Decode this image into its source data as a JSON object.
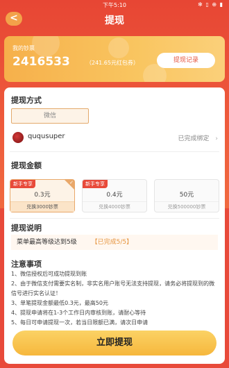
{
  "status_bar": {
    "time": "下午5:10",
    "icons": "✻ ▯ ⊕ ▮"
  },
  "nav": {
    "back_icon": "<",
    "title": "提现"
  },
  "balance": {
    "label": "我的钞票",
    "amount": "2416533",
    "note": "（241.65元红包券）",
    "record_button": "提现记录"
  },
  "withdraw_method": {
    "title": "提现方式",
    "selected_method": "微信",
    "username": "ququsuper",
    "bind_status": "已完成绑定"
  },
  "withdraw_amount": {
    "title": "提现金额",
    "options": [
      {
        "tag": "新手专享",
        "amount": "0.3元",
        "exchange": "兑换3000钞票",
        "selected": true
      },
      {
        "tag": "新手专享",
        "amount": "0.4元",
        "exchange": "兑换4000钞票",
        "selected": false
      },
      {
        "tag": "",
        "amount": "50元",
        "exchange": "兑换500000钞票",
        "selected": false
      }
    ]
  },
  "instructions": {
    "title": "提现说明",
    "requirement": "菜单最高等级达到5级",
    "status": "【已完成5/5】"
  },
  "notes": {
    "title": "注意事项",
    "items": [
      "1、微信授权后可成功提现到账",
      "2、由于微信支付需要实名制，非实名用户账号无法支持提现，请务必将提现到的微信号进行实名认证！",
      "3、单笔提现金额最低0.3元，最高50元",
      "4、提现申请将在1-3个工作日内审核到账，请耐心等待",
      "5、每日可申请提现一次，若当日限额已满，请次日申请"
    ]
  },
  "withdraw_button": "立即提现"
}
